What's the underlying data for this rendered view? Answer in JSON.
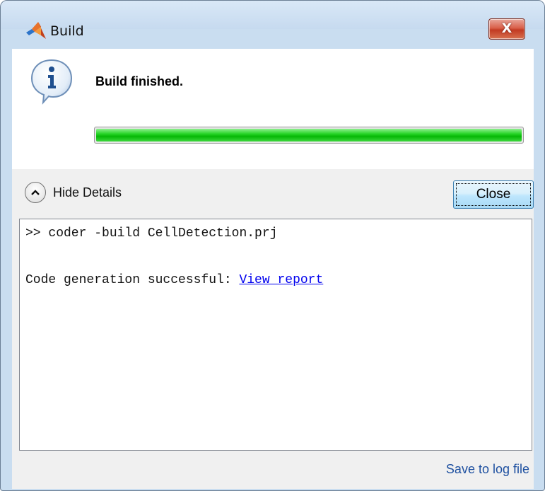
{
  "window": {
    "title": "Build",
    "close_glyph": "X"
  },
  "status": {
    "icon": "info-icon",
    "message": "Build finished.",
    "progress_percent": 100,
    "progress_color": "#06b806"
  },
  "details": {
    "toggle_label": "Hide Details",
    "toggle_icon": "chevron-up-icon",
    "close_label": "Close"
  },
  "console": {
    "command_line": ">> coder -build CellDetection.prj",
    "result_prefix": "Code generation successful: ",
    "report_link_text": "View report",
    "link_color": "#0000ee"
  },
  "footer": {
    "save_log_label": "Save to log file"
  }
}
